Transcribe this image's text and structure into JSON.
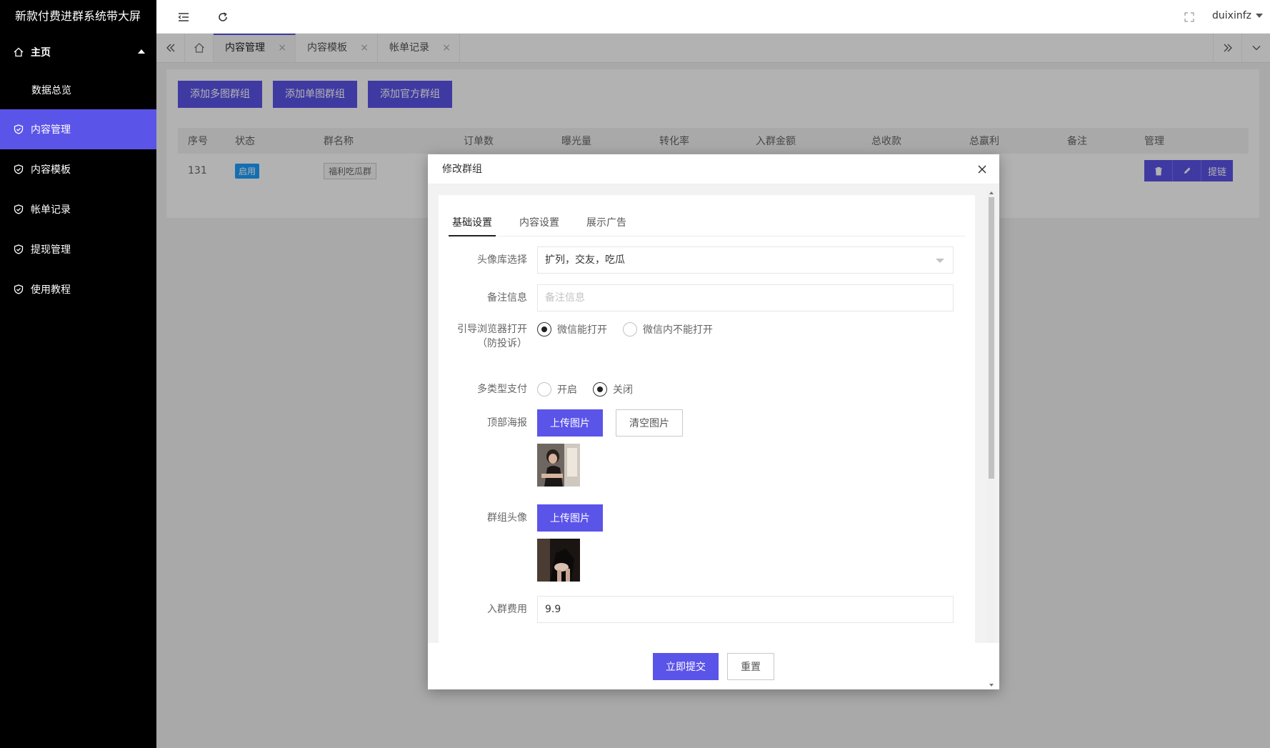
{
  "app": {
    "title": "新款付费进群系统带大屏"
  },
  "sidebar": {
    "items": [
      {
        "label": "主页",
        "icon": "home-icon"
      },
      {
        "label": "数据总览"
      },
      {
        "label": "内容管理",
        "icon": "shield-check-icon"
      },
      {
        "label": "内容模板",
        "icon": "shield-check-icon"
      },
      {
        "label": "帐单记录",
        "icon": "shield-check-icon"
      },
      {
        "label": "提现管理",
        "icon": "shield-check-icon"
      },
      {
        "label": "使用教程",
        "icon": "shield-check-icon"
      }
    ]
  },
  "header": {
    "username": "duixinfz"
  },
  "tabs": [
    {
      "label": "内容管理"
    },
    {
      "label": "内容模板"
    },
    {
      "label": "帐单记录"
    }
  ],
  "toolbar": {
    "add_multi": "添加多图群组",
    "add_single": "添加单图群组",
    "add_official": "添加官方群组"
  },
  "table": {
    "columns": [
      "序号",
      "状态",
      "群名称",
      "订单数",
      "曝光量",
      "转化率",
      "入群金额",
      "总收款",
      "总赢利",
      "备注",
      "管理"
    ],
    "rows": [
      {
        "id": "131",
        "status": "启用",
        "name": "福利吃瓜群",
        "link_label": "提链"
      }
    ]
  },
  "modal": {
    "title": "修改群组",
    "tabs": [
      "基础设置",
      "内容设置",
      "展示广告"
    ],
    "fields": {
      "avatar_lib": {
        "label": "头像库选择",
        "value": "扩列，交友，吃瓜"
      },
      "remark": {
        "label": "备注信息",
        "placeholder": "备注信息"
      },
      "browser": {
        "label": "引导浏览器打开（防投诉）",
        "options": [
          "微信能打开",
          "微信内不能打开"
        ],
        "selected": "微信能打开"
      },
      "multi_pay": {
        "label": "多类型支付",
        "options": [
          "开启",
          "关闭"
        ],
        "selected": "关闭"
      },
      "top_poster": {
        "label": "顶部海报",
        "upload": "上传图片",
        "clear": "清空图片"
      },
      "group_avatar": {
        "label": "群组头像",
        "upload": "上传图片"
      },
      "fee": {
        "label": "入群费用",
        "value": "9.9"
      }
    },
    "submit": "立即提交",
    "reset": "重置"
  },
  "colors": {
    "accent": "#5b54e8",
    "sidebar_bg": "#000000",
    "badge": "#1e9fff"
  }
}
